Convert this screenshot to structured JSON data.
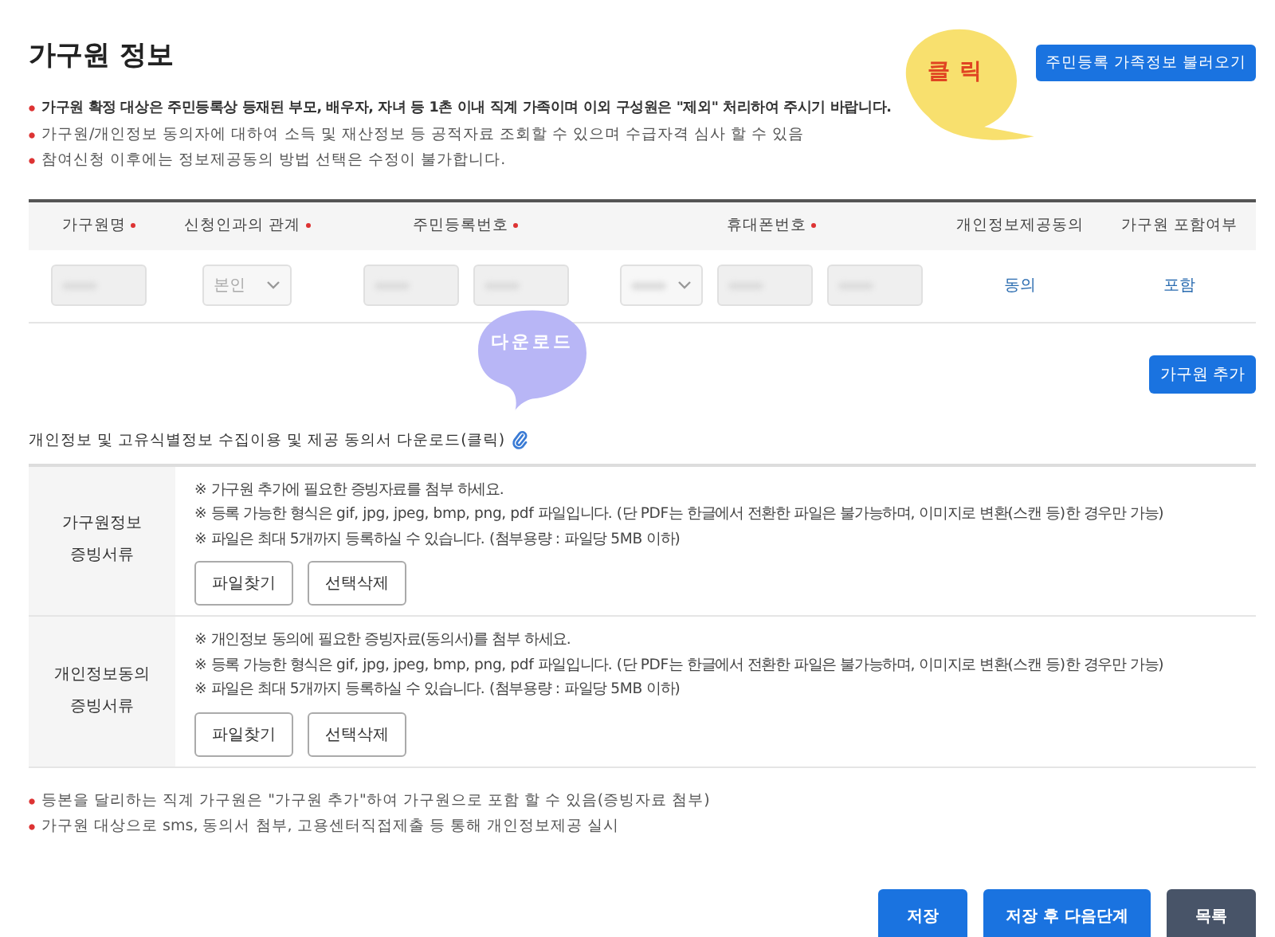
{
  "title": "가구원 정보",
  "load_button": "주민등록 가족정보 불러오기",
  "notes": [
    {
      "text": "가구원 확정 대상은 주민등록상 등재된 부모, 배우자, 자녀 등 1촌 이내 직계 가족이며 이외 구성원은 \"제외\" 처리하여 주시기 바랍니다.",
      "bold": true
    },
    {
      "text": "가구원/개인정보 동의자에 대하여 소득 및 재산정보 등 공적자료 조회할 수 있으며 수급자격 심사 할 수 있음",
      "bold": false
    },
    {
      "text": "참여신청 이후에는 정보제공동의 방법 선택은 수정이 불가합니다.",
      "bold": false
    }
  ],
  "table": {
    "columns": [
      {
        "label": "가구원명",
        "required": true
      },
      {
        "label": "신청인과의 관계",
        "required": true
      },
      {
        "label": "주민등록번호",
        "required": true
      },
      {
        "label": "휴대폰번호",
        "required": true
      },
      {
        "label": "개인정보제공동의",
        "required": false
      },
      {
        "label": "가구원 포함여부",
        "required": false
      }
    ],
    "rows": [
      {
        "name": {
          "kind": "masked"
        },
        "relation": {
          "kind": "select",
          "value": "본인"
        },
        "rrn": [
          {
            "kind": "masked"
          },
          {
            "kind": "masked"
          }
        ],
        "phone": [
          {
            "kind": "masked-select"
          },
          {
            "kind": "masked"
          },
          {
            "kind": "masked"
          }
        ],
        "consent": "동의",
        "include": "포함"
      }
    ]
  },
  "add_button": "가구원 추가",
  "download_link": "개인정보 및 고유식별정보 수집이용 및 제공 동의서 다운로드(클릭)",
  "attachments": [
    {
      "label": [
        "가구원정보",
        "증빙서류"
      ],
      "lines": [
        "※ 가구원 추가에 필요한 증빙자료를 첨부 하세요.",
        "※ 등록 가능한 형식은 gif, jpg, jpeg, bmp, png, pdf 파일입니다. (단 PDF는 한글에서 전환한 파일은 불가능하며, 이미지로 변환(스캔 등)한 경우만 가능)",
        "※ 파일은 최대 5개까지 등록하실 수 있습니다. (첨부용량 : 파일당 5MB 이하)"
      ],
      "buttons": [
        "파일찾기",
        "선택삭제"
      ]
    },
    {
      "label": [
        "개인정보동의",
        "증빙서류"
      ],
      "lines": [
        "※ 개인정보 동의에 필요한 증빙자료(동의서)를 첨부 하세요.",
        "※ 등록 가능한 형식은 gif, jpg, jpeg, bmp, png, pdf 파일입니다. (단 PDF는 한글에서 전환한 파일은 불가능하며, 이미지로 변환(스캔 등)한 경우만 가능)",
        "※ 파일은 최대 5개까지 등록하실 수 있습니다. (첨부용량 : 파일당 5MB 이하)"
      ],
      "buttons": [
        "파일찾기",
        "선택삭제"
      ]
    }
  ],
  "footer_notes": [
    "등본을 달리하는 직계 가구원은 \"가구원 추가\"하여 가구원으로 포함 할 수 있음(증빙자료 첨부)",
    "가구원 대상으로 sms, 동의서 첨부, 고용센터직접제출 등 통해 개인정보제공 실시"
  ],
  "actions": [
    {
      "label": "저장",
      "kind": "primary"
    },
    {
      "label": "저장 후 다음단계",
      "kind": "primary"
    },
    {
      "label": "목록",
      "kind": "secondary"
    }
  ],
  "annotations": [
    {
      "text": "클릭",
      "kind": "click",
      "color": "#f8e06e"
    },
    {
      "text": "다운로드",
      "kind": "download",
      "color": "#b8b6f6"
    }
  ]
}
